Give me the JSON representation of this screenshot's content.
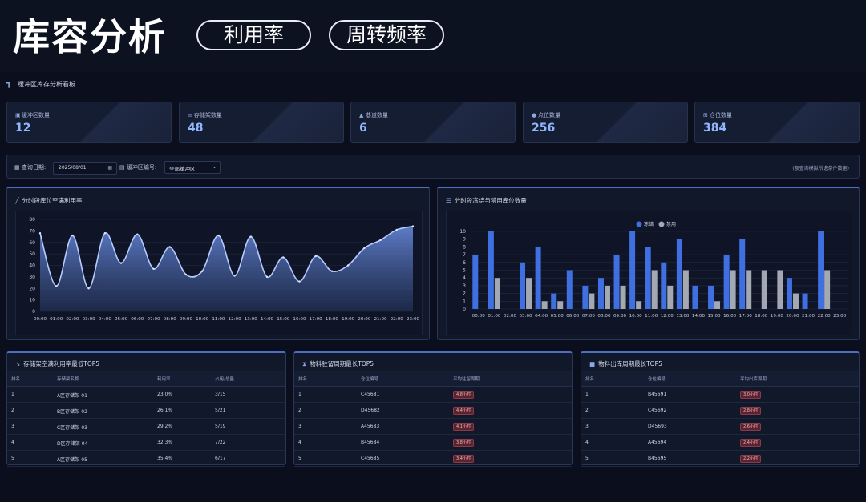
{
  "hero": {
    "title": "库容分析",
    "pill1": "利用率",
    "pill2": "周转频率"
  },
  "board": {
    "title": "缓冲区库存分析看板"
  },
  "stats": [
    {
      "label": "缓冲区数量",
      "value": "12"
    },
    {
      "label": "存储架数量",
      "value": "48"
    },
    {
      "label": "巷道数量",
      "value": "6"
    },
    {
      "label": "点位数量",
      "value": "256"
    },
    {
      "label": "仓位数量",
      "value": "384"
    }
  ],
  "query": {
    "date_label": "查询日期:",
    "date_value": "2025/08/01",
    "zone_label": "缓冲区编号:",
    "zone_value": "全部缓冲区",
    "note": "(额查询模拟所选条件数据)"
  },
  "chart_data": [
    {
      "type": "area",
      "title": "分时段库位空满利用率",
      "x": [
        "00:00",
        "01:00",
        "02:00",
        "03:00",
        "04:00",
        "05:00",
        "06:00",
        "07:00",
        "08:00",
        "09:00",
        "10:00",
        "11:00",
        "12:00",
        "13:00",
        "14:00",
        "15:00",
        "16:00",
        "17:00",
        "18:00",
        "19:00",
        "20:00",
        "21:00",
        "22:00",
        "23:00"
      ],
      "values": [
        68,
        22,
        66,
        20,
        68,
        42,
        67,
        37,
        56,
        32,
        35,
        66,
        31,
        65,
        30,
        47,
        26,
        48,
        35,
        40,
        55,
        62,
        71,
        74
      ],
      "ylim": [
        0,
        80
      ],
      "yticks": [
        0,
        10,
        20,
        30,
        40,
        50,
        60,
        70,
        80
      ],
      "grid": true
    },
    {
      "type": "bar",
      "title": "分时段冻结与禁用库位数量",
      "categories": [
        "00:00",
        "01:00",
        "02:00",
        "03:00",
        "04:00",
        "05:00",
        "06:00",
        "07:00",
        "08:00",
        "09:00",
        "10:00",
        "11:00",
        "12:00",
        "13:00",
        "14:00",
        "15:00",
        "16:00",
        "17:00",
        "18:00",
        "19:00",
        "20:00",
        "21:00",
        "22:00",
        "23:00"
      ],
      "series": [
        {
          "name": "冻结",
          "color": "#3f6fe0",
          "values": [
            7,
            10,
            0,
            6,
            8,
            2,
            5,
            3,
            4,
            7,
            10,
            8,
            6,
            9,
            3,
            3,
            7,
            9,
            0,
            0,
            4,
            2,
            10,
            0
          ]
        },
        {
          "name": "禁用",
          "color": "#a3a8b3",
          "values": [
            0,
            4,
            0,
            4,
            1,
            1,
            0,
            2,
            3,
            3,
            1,
            5,
            3,
            5,
            0,
            1,
            5,
            5,
            5,
            5,
            2,
            0,
            5,
            0
          ]
        }
      ],
      "ylim": [
        0,
        10
      ],
      "yticks": [
        0,
        1,
        2,
        3,
        4,
        5,
        6,
        7,
        8,
        9,
        10
      ],
      "legend": "top-center",
      "grid": true
    }
  ],
  "tables": [
    {
      "title": "存储架空满利用率最低TOP5",
      "headers": [
        "排名",
        "存储架名称",
        "利用率",
        "占用/总量"
      ],
      "rows": [
        [
          "1",
          "A区存储架-01",
          "23.0%",
          "3/15"
        ],
        [
          "2",
          "B区存储架-02",
          "26.1%",
          "5/21"
        ],
        [
          "3",
          "C区存储架-03",
          "29.2%",
          "5/19"
        ],
        [
          "4",
          "D区存储架-04",
          "32.3%",
          "7/22"
        ],
        [
          "5",
          "A区存储架-05",
          "35.4%",
          "6/17"
        ]
      ]
    },
    {
      "title": "物料驻留周期最长TOP5",
      "headers": [
        "排名",
        "仓位编号",
        "平均驻留周期"
      ],
      "rows": [
        [
          "1",
          "C45681",
          "4.8小时"
        ],
        [
          "2",
          "D45682",
          "4.4小时"
        ],
        [
          "3",
          "A45683",
          "4.1小时"
        ],
        [
          "4",
          "B45684",
          "3.8小时"
        ],
        [
          "5",
          "C45685",
          "3.4小时"
        ]
      ]
    },
    {
      "title": "物料出库周期最长TOP5",
      "headers": [
        "排名",
        "仓位编号",
        "平均出库周期"
      ],
      "rows": [
        [
          "1",
          "B45691",
          "3.0小时"
        ],
        [
          "2",
          "C45692",
          "2.8小时"
        ],
        [
          "3",
          "D45693",
          "2.6小时"
        ],
        [
          "4",
          "A45694",
          "2.4小时"
        ],
        [
          "5",
          "B45695",
          "2.2小时"
        ]
      ]
    }
  ]
}
